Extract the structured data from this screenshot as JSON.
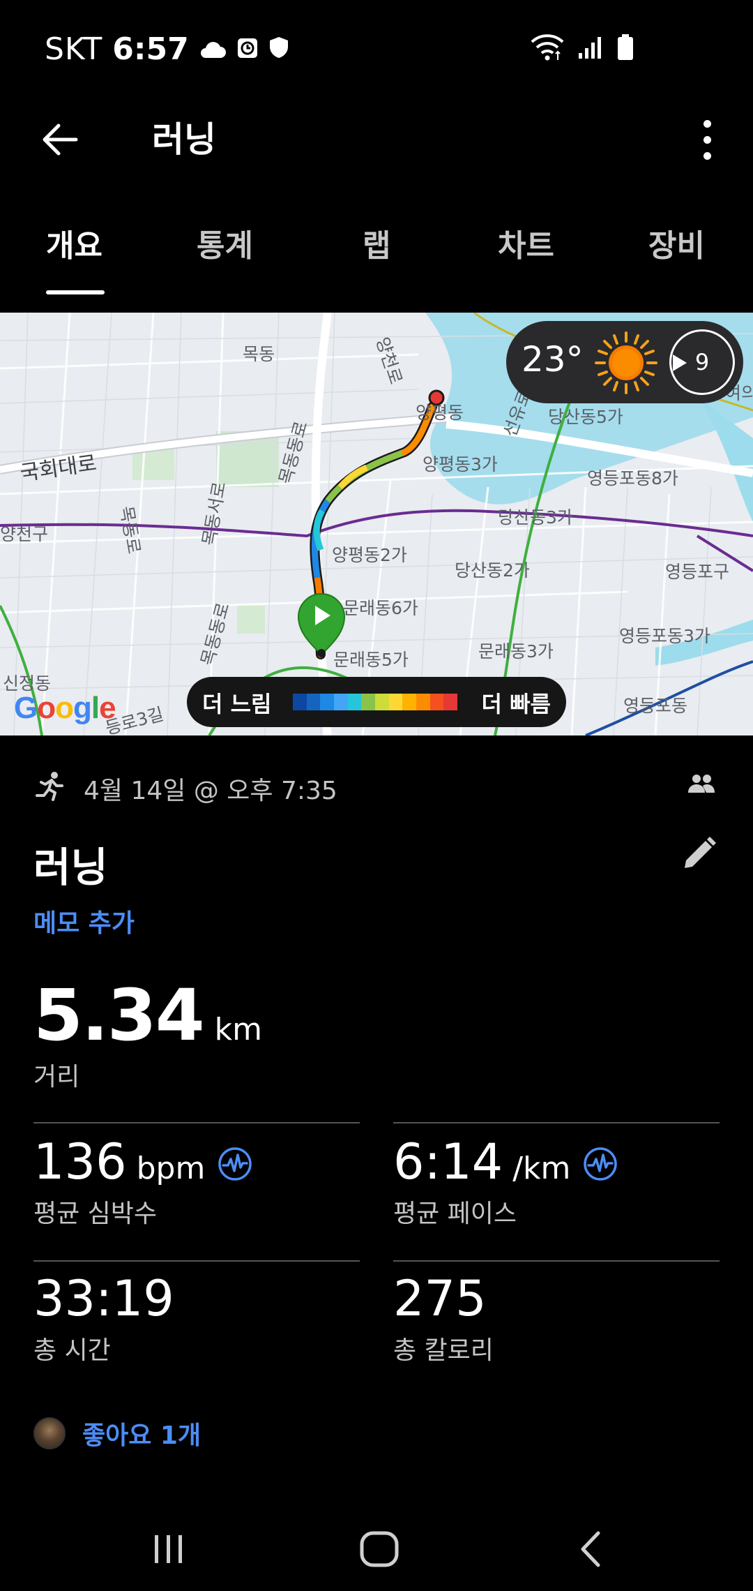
{
  "status_bar": {
    "carrier": "SKT",
    "time": "6:57",
    "icons": [
      "cloud-icon",
      "clock-icon",
      "shield-icon",
      "wifi-icon",
      "signal-icon",
      "battery-icon"
    ]
  },
  "app_bar": {
    "title": "러닝",
    "back_icon": "back-arrow-icon",
    "more_icon": "more-vertical-icon"
  },
  "tabs": [
    {
      "label": "개요",
      "active": true
    },
    {
      "label": "통계",
      "active": false
    },
    {
      "label": "랩",
      "active": false
    },
    {
      "label": "차트",
      "active": false
    },
    {
      "label": "장비",
      "active": false
    }
  ],
  "map": {
    "weather": {
      "temperature": "23°",
      "wind_speed": "9",
      "icon": "sun-icon"
    },
    "legend": {
      "slow_label": "더 느림",
      "fast_label": "더 빠름",
      "colors": [
        "#0d47a1",
        "#1565c0",
        "#1e88e5",
        "#42a5f5",
        "#26c6da",
        "#8bc34a",
        "#cddc39",
        "#fdd835",
        "#ffb300",
        "#fb8c00",
        "#f4511e",
        "#e53935"
      ]
    },
    "logo": "Google",
    "labels": [
      "목동",
      "양천로",
      "목동동로",
      "국회대로",
      "양평동",
      "선유로",
      "당산동5가",
      "양평동3가",
      "영등포동8가",
      "목동서로",
      "목동로",
      "양천구",
      "당산동3가",
      "양평동2가",
      "당산동2가",
      "영등포구",
      "문래동6가",
      "목동동로",
      "영등포동3가",
      "문래동3가",
      "문래동5가",
      "신정동",
      "영등포동",
      "등로3길",
      "여의"
    ],
    "accent": "#31a52f"
  },
  "activity": {
    "date": "4월 14일 @ 오후 7:35",
    "title": "러닝",
    "memo_link": "메모 추가",
    "distance": {
      "value": "5.34",
      "unit": "km",
      "label": "거리"
    },
    "stats": [
      {
        "value": "136",
        "unit": "bpm",
        "label": "평균 심박수",
        "icon": "heart-rate-icon"
      },
      {
        "value": "6:14",
        "unit": "/km",
        "label": "평균 페이스",
        "icon": "heart-rate-icon"
      },
      {
        "value": "33:19",
        "unit": "",
        "label": "총 시간"
      },
      {
        "value": "275",
        "unit": "",
        "label": "총 칼로리"
      }
    ],
    "likes": "좋아요 1개",
    "link_color": "#4c8df5"
  },
  "nav_bar": {
    "items": [
      "recent-apps-icon",
      "home-icon",
      "back-icon"
    ]
  }
}
